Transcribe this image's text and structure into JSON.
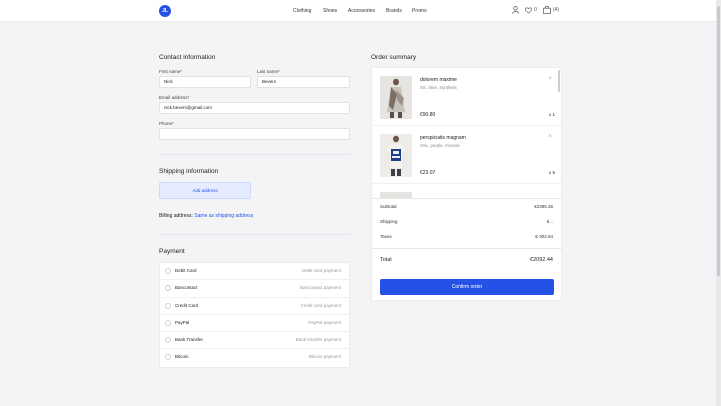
{
  "header": {
    "logo_text": "JL",
    "nav": [
      "Clothing",
      "Shoes",
      "Accessories",
      "Brands",
      "Promo"
    ],
    "wishlist_count": "0",
    "cart_count": "(4)"
  },
  "contact": {
    "title": "Contact information",
    "first_name_label": "First name*",
    "first_name_value": "Nick",
    "last_name_label": "Last name*",
    "last_name_value": "Bevers",
    "email_label": "Email address*",
    "email_value": "nick.bevers@gmail.com",
    "phone_label": "Phone*",
    "phone_value": ""
  },
  "shipping": {
    "title": "Shipping information",
    "add_address": "Add address",
    "billing_label": "Billing address:",
    "billing_link": "Same as shipping address"
  },
  "payment": {
    "title": "Payment",
    "methods": [
      {
        "name": "Debit Card",
        "desc": "Debit card payment"
      },
      {
        "name": "Bancontact",
        "desc": "Bancontact payment"
      },
      {
        "name": "Credit Card",
        "desc": "Credit card payment"
      },
      {
        "name": "PayPal",
        "desc": "PayPal payment"
      },
      {
        "name": "Bank Transfer",
        "desc": "Bank transfer payment"
      },
      {
        "name": "Bitcoin",
        "desc": "Bitcoin payment"
      }
    ]
  },
  "summary": {
    "title": "Order summary",
    "items": [
      {
        "name": "dolorem maxime",
        "meta": "XS, olive, Synthetic",
        "price": "€90.80",
        "qty": "x 1"
      },
      {
        "name": "perspiciatis magnam",
        "meta": "XXL, purple, Viscose",
        "price": "€23.07",
        "qty": "x 6"
      }
    ],
    "subtotal_label": "Subtotal",
    "subtotal_value": "€2395.36",
    "shipping_label": "Shipping",
    "shipping_value": "€...",
    "taxes_label": "Taxes",
    "taxes_value": "€-302.94",
    "total_label": "Total",
    "total_value": "€2092.44",
    "confirm_label": "Confirm order"
  }
}
